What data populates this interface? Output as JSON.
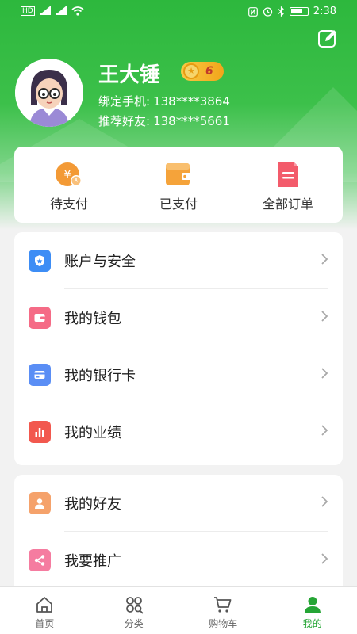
{
  "status_bar": {
    "time": "2:38",
    "left_text": "HD"
  },
  "profile": {
    "name": "王大锤",
    "level": "6",
    "phone_label": "绑定手机:",
    "phone": "138****3864",
    "referrer_label": "推荐好友:",
    "referrer": "138****5661"
  },
  "orders": [
    {
      "label": "待支付",
      "icon": "pending-payment-icon"
    },
    {
      "label": "已支付",
      "icon": "wallet-paid-icon"
    },
    {
      "label": "全部订单",
      "icon": "order-list-icon"
    }
  ],
  "menu_group_1": [
    {
      "label": "账户与安全",
      "icon": "shield-icon",
      "color": "#3d8df5"
    },
    {
      "label": "我的钱包",
      "icon": "wallet-icon",
      "color": "#f56b86"
    },
    {
      "label": "我的银行卡",
      "icon": "bank-card-icon",
      "color": "#5a8ef5"
    },
    {
      "label": "我的业绩",
      "icon": "bar-chart-icon",
      "color": "#f2584e"
    }
  ],
  "menu_group_2": [
    {
      "label": "我的好友",
      "icon": "friend-icon",
      "color": "#f5a26b"
    },
    {
      "label": "我要推广",
      "icon": "share-icon",
      "color": "#f57ca0"
    }
  ],
  "tabs": [
    {
      "label": "首页",
      "icon": "home-icon"
    },
    {
      "label": "分类",
      "icon": "category-icon"
    },
    {
      "label": "购物车",
      "icon": "cart-icon"
    },
    {
      "label": "我的",
      "icon": "profile-icon",
      "active": true
    }
  ],
  "colors": {
    "primary": "#2db83d",
    "active_tab": "#25a535"
  }
}
